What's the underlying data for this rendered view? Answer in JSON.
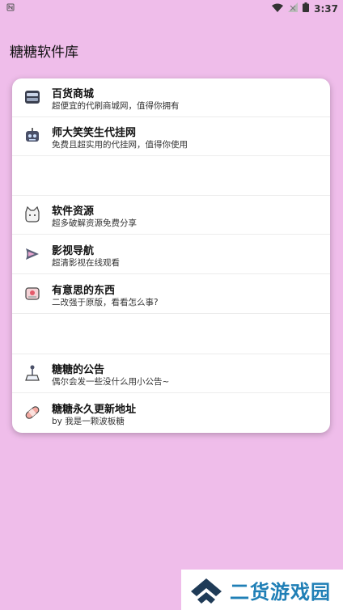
{
  "status_bar": {
    "left_icon": "nfc-icon",
    "time": "3:37"
  },
  "app": {
    "title": "糖糖软件库"
  },
  "list": {
    "items": [
      {
        "title": "百货商城",
        "subtitle": "超便宜的代刷商城网，值得你拥有",
        "icon": "store-icon"
      },
      {
        "title": "师大笑笑生代挂网",
        "subtitle": "免费且超实用的代挂网，值得你使用",
        "icon": "robot-icon"
      },
      {
        "title": "",
        "subtitle": ""
      },
      {
        "title": "软件资源",
        "subtitle": "超多破解资源免费分享",
        "icon": "cat-icon"
      },
      {
        "title": "影视导航",
        "subtitle": "超清影视在线观看",
        "icon": "play-icon"
      },
      {
        "title": "有意思的东西",
        "subtitle": "二改强于原版，看看怎么事?",
        "icon": "gift-box-icon"
      },
      {
        "title": "",
        "subtitle": ""
      },
      {
        "title": "糖糖的公告",
        "subtitle": "偶尔会发一些没什么用小公告~",
        "icon": "joystick-icon"
      },
      {
        "title": "糖糖永久更新地址",
        "subtitle": "by 我是一颗波板糖",
        "icon": "bandage-icon"
      }
    ]
  },
  "watermark": {
    "text": "二货游戏园"
  }
}
